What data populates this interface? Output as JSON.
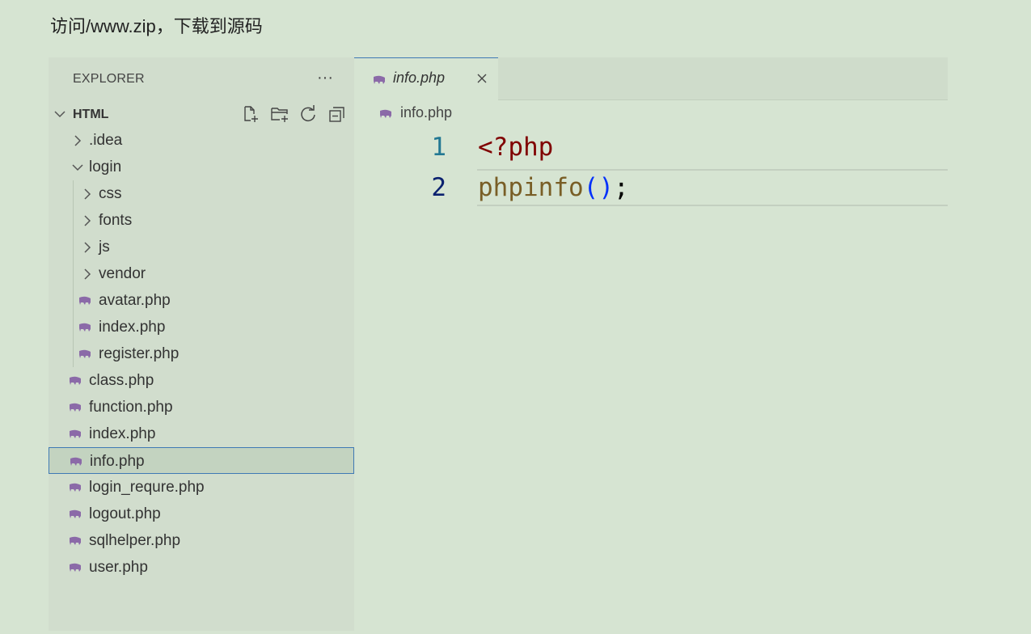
{
  "caption": "访问/www.zip，下载到源码",
  "explorer": {
    "title": "EXPLORER",
    "more_label": "···",
    "section_title": "HTML",
    "tools": [
      "new-file-icon",
      "new-folder-icon",
      "refresh-icon",
      "collapse-all-icon"
    ]
  },
  "tree": [
    {
      "label": ".idea",
      "type": "folder",
      "expanded": false,
      "depth": 1
    },
    {
      "label": "login",
      "type": "folder",
      "expanded": true,
      "depth": 1
    },
    {
      "label": "css",
      "type": "folder",
      "expanded": false,
      "depth": 2
    },
    {
      "label": "fonts",
      "type": "folder",
      "expanded": false,
      "depth": 2
    },
    {
      "label": "js",
      "type": "folder",
      "expanded": false,
      "depth": 2
    },
    {
      "label": "vendor",
      "type": "folder",
      "expanded": false,
      "depth": 2
    },
    {
      "label": "avatar.php",
      "type": "php",
      "depth": 2
    },
    {
      "label": "index.php",
      "type": "php",
      "depth": 2
    },
    {
      "label": "register.php",
      "type": "php",
      "depth": 2
    },
    {
      "label": "class.php",
      "type": "php",
      "depth": 1
    },
    {
      "label": "function.php",
      "type": "php",
      "depth": 1
    },
    {
      "label": "index.php",
      "type": "php",
      "depth": 1
    },
    {
      "label": "info.php",
      "type": "php",
      "depth": 1,
      "selected": true
    },
    {
      "label": "login_requre.php",
      "type": "php",
      "depth": 1
    },
    {
      "label": "logout.php",
      "type": "php",
      "depth": 1
    },
    {
      "label": "sqlhelper.php",
      "type": "php",
      "depth": 1
    },
    {
      "label": "user.php",
      "type": "php",
      "depth": 1
    }
  ],
  "editor": {
    "tab_label": "info.php",
    "breadcrumb": "info.php",
    "lines": [
      {
        "num": "1",
        "tokens": [
          {
            "t": "<?php",
            "c": "kw"
          }
        ]
      },
      {
        "num": "2",
        "tokens": [
          {
            "t": "phpinfo",
            "c": "fn"
          },
          {
            "t": "()",
            "c": "pn"
          },
          {
            "t": ";",
            "c": "semi"
          }
        ]
      }
    ]
  },
  "colors": {
    "background": "#d6e4d2",
    "sidebar": "#d1ddcd",
    "selection_border": "#3f79b4",
    "php_icon": "#8b6aa8",
    "keyword": "#800000",
    "function": "#795e26",
    "paren": "#0431fa"
  }
}
